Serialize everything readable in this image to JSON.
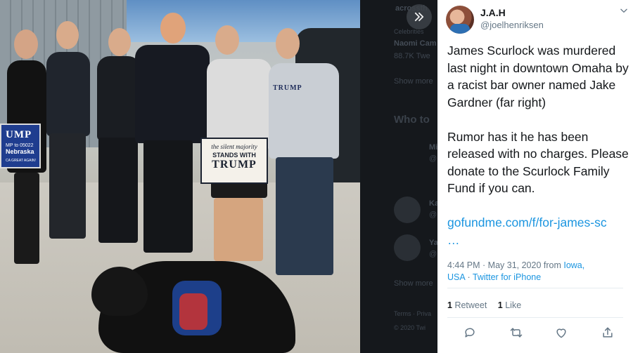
{
  "photo": {
    "sign_small": "the silent majority",
    "sign_mid": "STANDS WITH",
    "sign_big": "TRUMP",
    "blue_sign_big": "UMP",
    "blue_sign_small": "MP to 05022",
    "blue_sign_place": "Nebraska",
    "blue_sign_slogan": "CA GREAT AGAIN!",
    "shirt_text": "TRUMP"
  },
  "background_page": {
    "item1": "acrossth",
    "item2": "Celebrities",
    "item3": "Naomi Cam",
    "item4": "88.7K Twe",
    "item5": "Show more",
    "item6": "Who to",
    "item7": "Mi",
    "item8": "@",
    "item9": "Ka",
    "item10": "@",
    "item11": "Ya",
    "item12": "@",
    "item13": "Show more",
    "item14": "Terms · Priva",
    "item15": "© 2020 Twi"
  },
  "expand_icon": "double-chevron-right-icon",
  "tweet": {
    "name": "J.A.H",
    "handle": "@joelhenriksen",
    "text_p1": "James Scurlock was murdered last night in downtown Omaha by a racist bar owner named Jake Gardner (far right)",
    "text_p2": "Rumor has it he has been released with no charges. Please donate to the Scurlock Family Fund if you can.",
    "link": "gofundme.com/f/for-james-sc",
    "link_ellipsis": "…",
    "time_date": "4:44 PM · May 31, 2020 from ",
    "location": "Iowa,",
    "location2": "USA",
    "separator": " · ",
    "source": "Twitter for iPhone",
    "retweets_count": "1",
    "retweets_label": "Retweet",
    "likes_count": "1",
    "likes_label": "Like"
  }
}
